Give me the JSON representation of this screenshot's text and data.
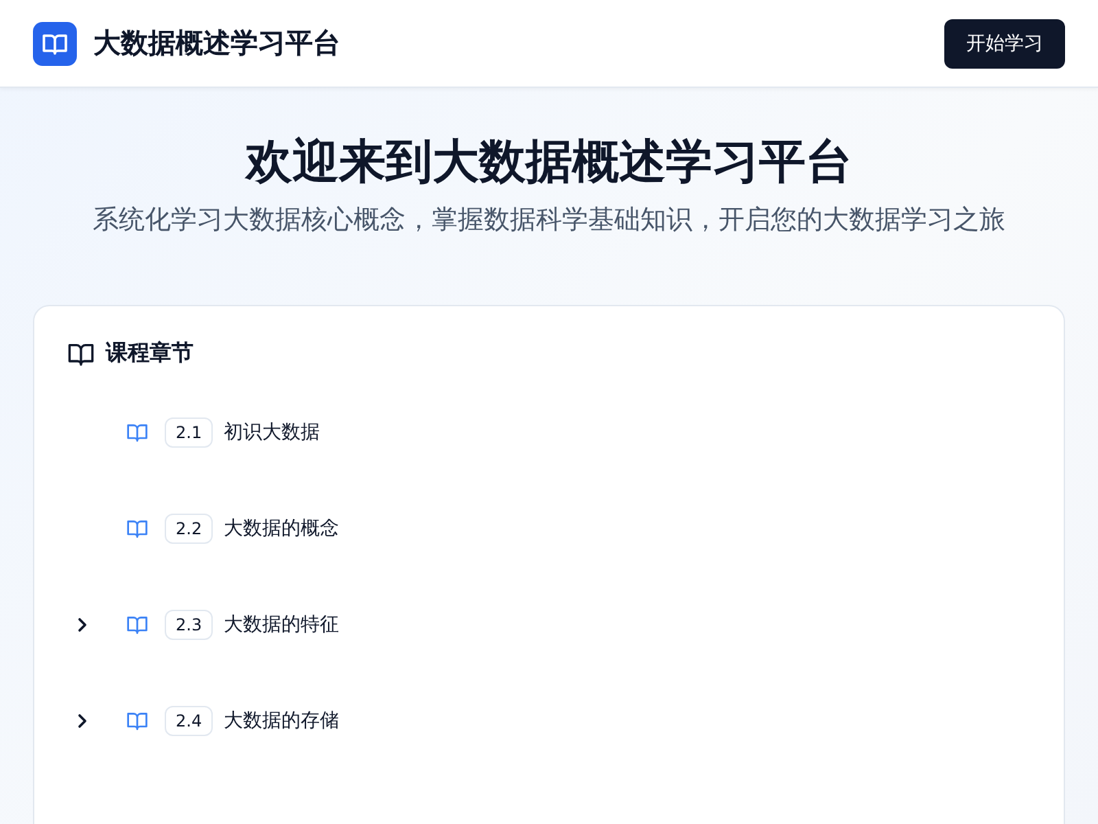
{
  "header": {
    "title": "大数据概述学习平台",
    "button": "开始学习"
  },
  "hero": {
    "title": "欢迎来到大数据概述学习平台",
    "subtitle": "系统化学习大数据核心概念，掌握数据科学基础知识，开启您的大数据学习之旅"
  },
  "chapters": {
    "title": "课程章节",
    "items": [
      {
        "number": "2.1",
        "label": "初识大数据",
        "expandable": false
      },
      {
        "number": "2.2",
        "label": "大数据的概念",
        "expandable": false
      },
      {
        "number": "2.3",
        "label": "大数据的特征",
        "expandable": true
      },
      {
        "number": "2.4",
        "label": "大数据的存储",
        "expandable": true
      }
    ]
  }
}
